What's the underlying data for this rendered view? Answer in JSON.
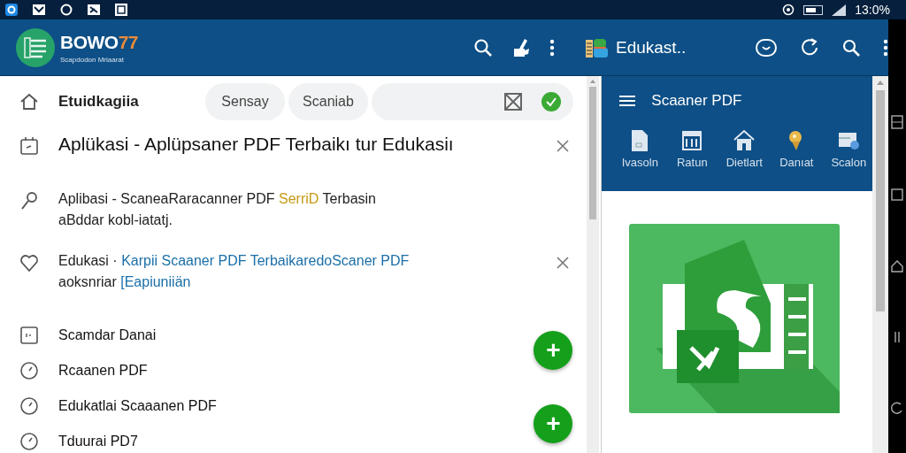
{
  "status_bar": {
    "time": "13:0%"
  },
  "app_bar": {
    "brand": {
      "text": "BOWO",
      "accent": "77"
    },
    "subtitle": "Scapdodon Mriaarat",
    "right_title": "Edukast.."
  },
  "left_panel": {
    "header": {
      "title": "Etuidkagiia",
      "chips": [
        "Sensay",
        "Scaniab"
      ],
      "search": {
        "checked": true
      }
    },
    "cards": [
      {
        "closable": true,
        "lines": [
          [
            {
              "kind": "plain",
              "text": "Aplükasi - Aplüpsaner PDF Terbaikı tur Edukasiı"
            }
          ]
        ]
      },
      {
        "closable": false,
        "lines": [
          [
            {
              "kind": "plain",
              "text": "Aplibasi - ScaneaRaracanner PDF "
            },
            {
              "kind": "highlight",
              "text": "SerriD"
            },
            {
              "kind": "plain",
              "text": " Terbasin"
            }
          ],
          [
            {
              "kind": "plain",
              "text": "aBddar kobl-iatatj."
            }
          ]
        ]
      },
      {
        "closable": true,
        "lines": [
          [
            {
              "kind": "plain",
              "text": "Edukasi · "
            },
            {
              "kind": "link",
              "text": "Karpii Scaaner PDF TerbaikaredoScaner PDF"
            }
          ],
          [
            {
              "kind": "plain",
              "text": "aoksnriar "
            },
            {
              "kind": "link",
              "text": "[Eapiuniiän"
            }
          ]
        ]
      }
    ],
    "items": [
      {
        "label": "Scamdar Danai"
      },
      {
        "label": "Rcaanen PDF"
      },
      {
        "label": "Edukatlai Scaaanen PDF"
      },
      {
        "label": "Tduurai PD7"
      }
    ],
    "fabs": [
      "+",
      "+"
    ]
  },
  "right_panel": {
    "title": "Scaaner PDF",
    "tabs": [
      {
        "label": "Ivasoln"
      },
      {
        "label": "Ratun"
      },
      {
        "label": "Dietlart"
      },
      {
        "label": "Danıat"
      },
      {
        "label": "Scalon"
      }
    ]
  }
}
